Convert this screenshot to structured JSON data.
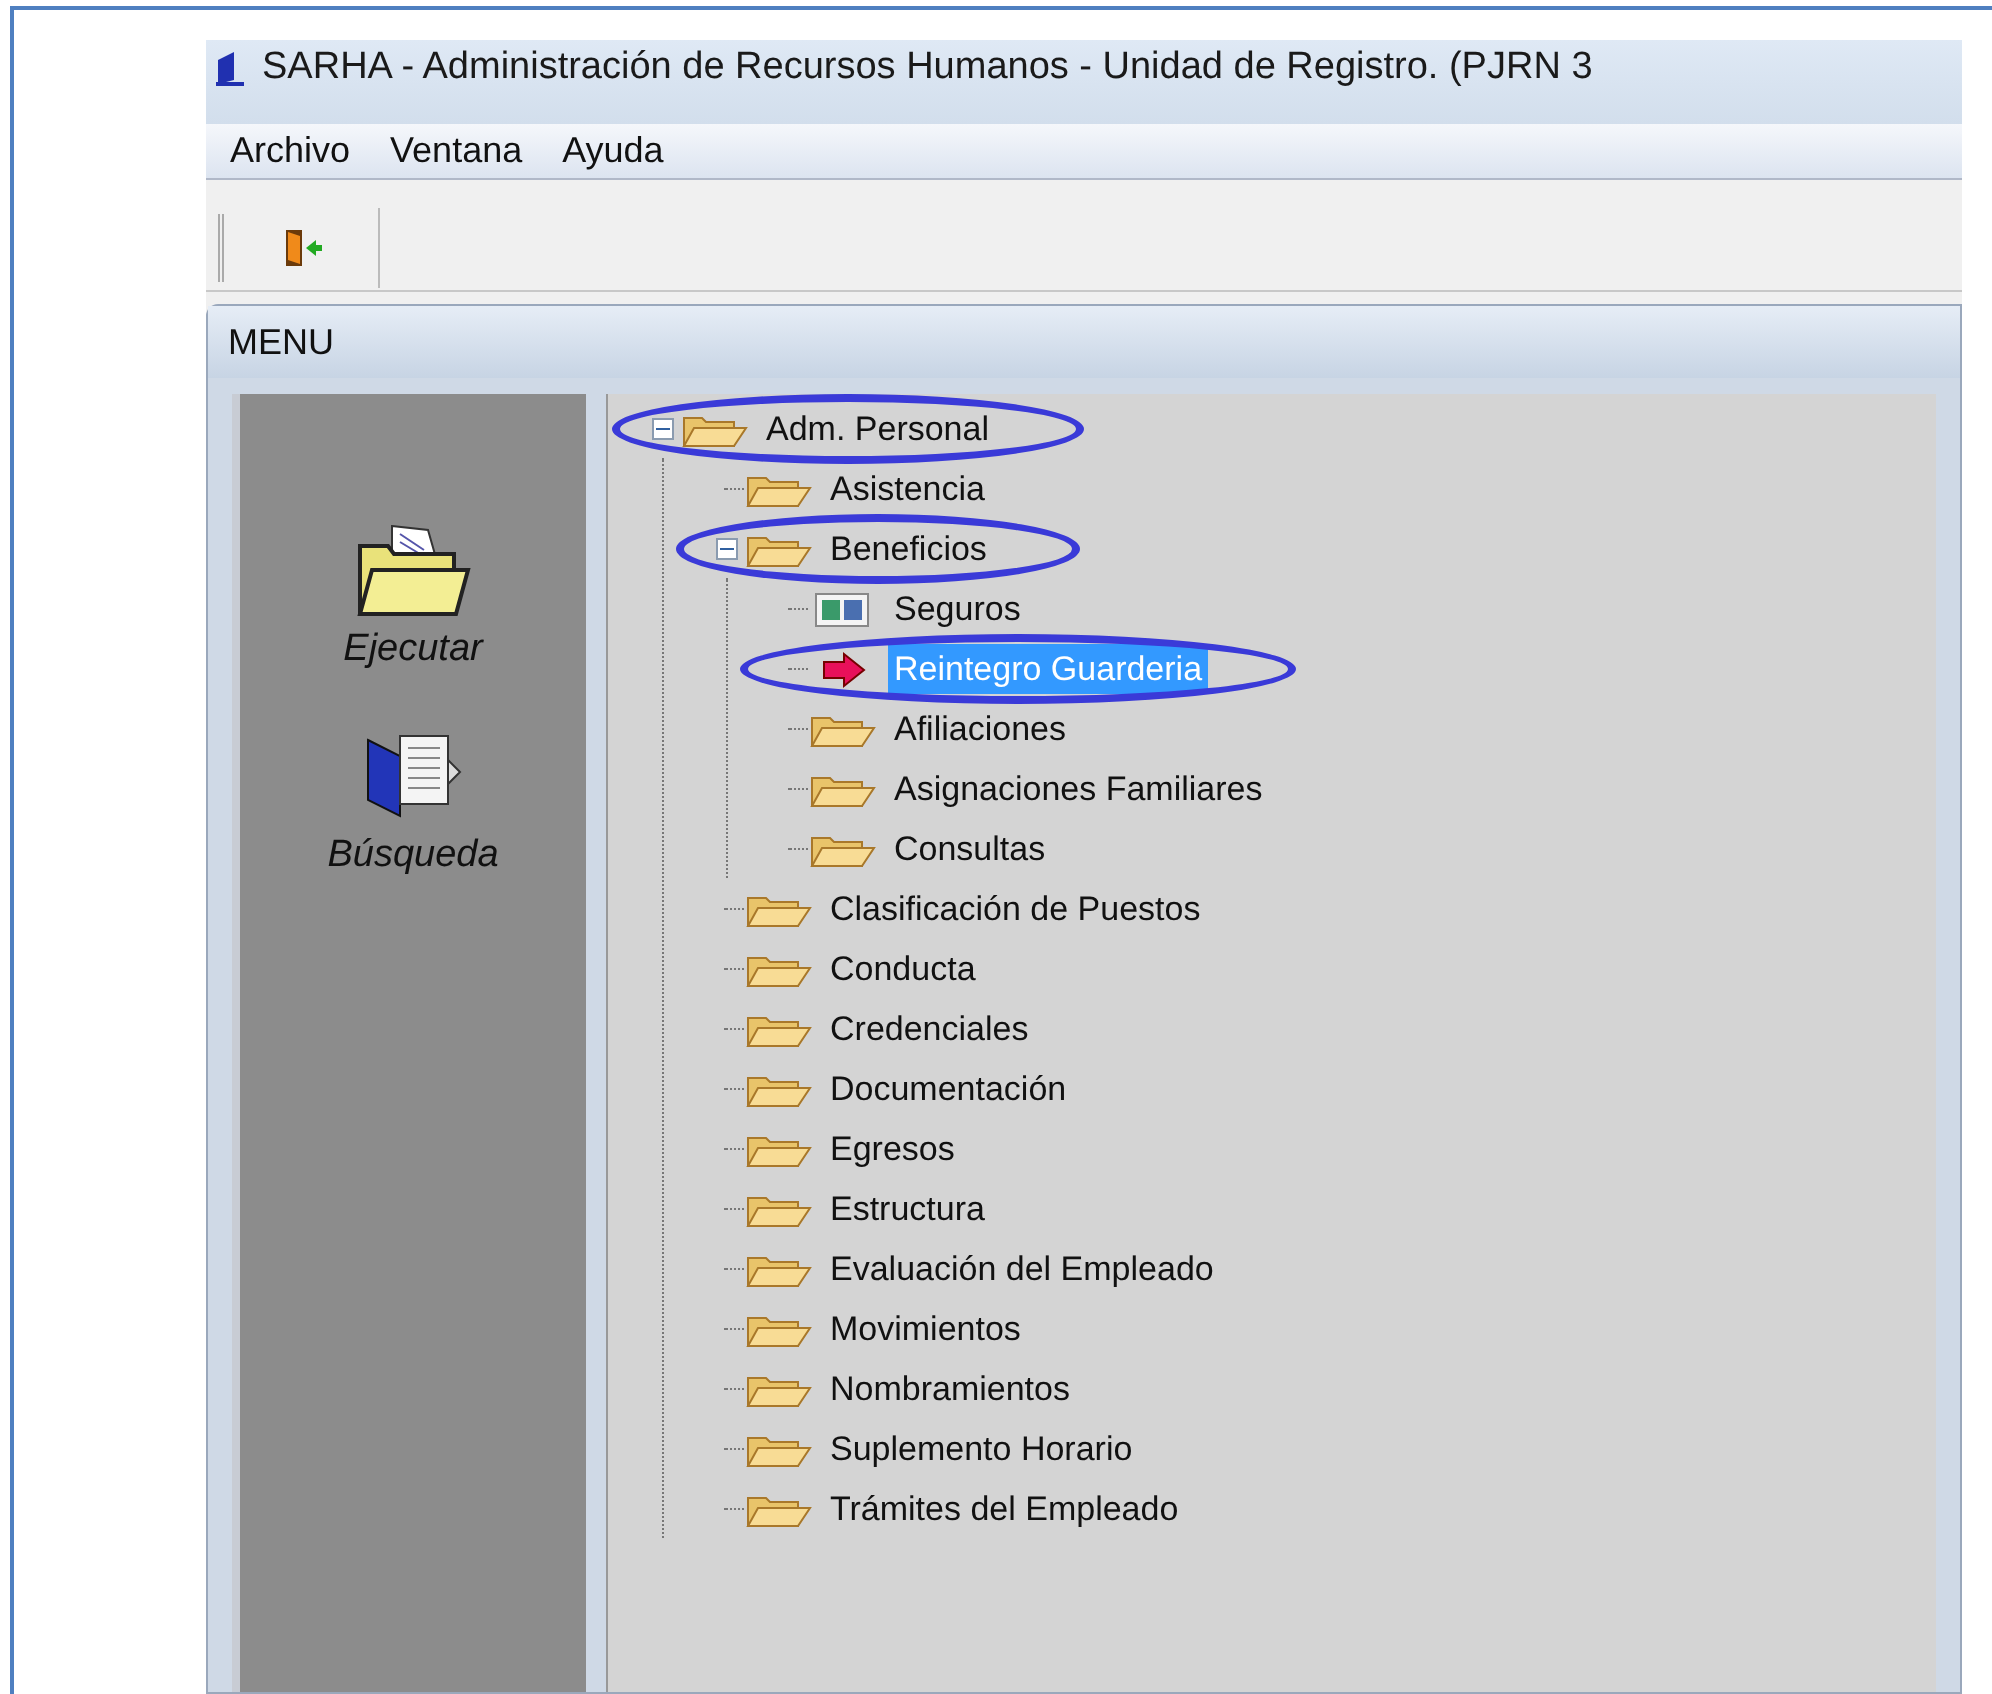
{
  "window": {
    "title": "SARHA - Administración de Recursos Humanos - Unidad de Registro. (PJRN 3"
  },
  "menu_bar": [
    "Archivo",
    "Ventana",
    "Ayuda"
  ],
  "menu_window": {
    "title": "MENU"
  },
  "sidebar": {
    "items": [
      {
        "label": "Ejecutar",
        "kind": "open-folder"
      },
      {
        "label": "Búsqueda",
        "kind": "book"
      }
    ]
  },
  "tree": [
    {
      "label": "Adm. Personal",
      "kind": "folder",
      "expanded": true,
      "selected": false,
      "circled": true,
      "children": [
        {
          "label": "Asistencia",
          "kind": "folder",
          "selected": false,
          "circled": false
        },
        {
          "label": "Beneficios",
          "kind": "folder",
          "expanded": true,
          "selected": false,
          "circled": true,
          "children": [
            {
              "label": "Seguros",
              "kind": "form",
              "selected": false,
              "circled": false
            },
            {
              "label": "Reintegro Guarderia",
              "kind": "arrow",
              "selected": true,
              "circled": true
            },
            {
              "label": "Afiliaciones",
              "kind": "folder",
              "selected": false,
              "circled": false
            },
            {
              "label": "Asignaciones Familiares",
              "kind": "folder",
              "selected": false,
              "circled": false
            },
            {
              "label": "Consultas",
              "kind": "folder",
              "selected": false,
              "circled": false
            }
          ]
        },
        {
          "label": "Clasificación de Puestos",
          "kind": "folder",
          "selected": false,
          "circled": false
        },
        {
          "label": "Conducta",
          "kind": "folder",
          "selected": false,
          "circled": false
        },
        {
          "label": "Credenciales",
          "kind": "folder",
          "selected": false,
          "circled": false
        },
        {
          "label": "Documentación",
          "kind": "folder",
          "selected": false,
          "circled": false
        },
        {
          "label": "Egresos",
          "kind": "folder",
          "selected": false,
          "circled": false
        },
        {
          "label": "Estructura",
          "kind": "folder",
          "selected": false,
          "circled": false
        },
        {
          "label": "Evaluación del Empleado",
          "kind": "folder",
          "selected": false,
          "circled": false
        },
        {
          "label": "Movimientos",
          "kind": "folder",
          "selected": false,
          "circled": false
        },
        {
          "label": "Nombramientos",
          "kind": "folder",
          "selected": false,
          "circled": false
        },
        {
          "label": "Suplemento Horario",
          "kind": "folder",
          "selected": false,
          "circled": false
        },
        {
          "label": "Trámites del Empleado",
          "kind": "folder",
          "selected": false,
          "circled": false
        }
      ]
    }
  ]
}
